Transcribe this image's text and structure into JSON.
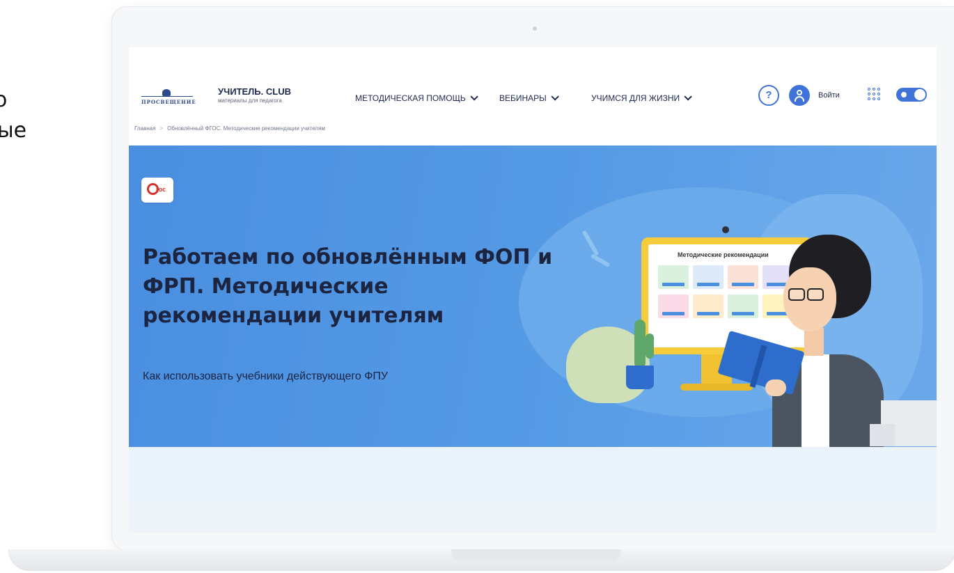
{
  "slide": {
    "line1": "о",
    "line2": "ые"
  },
  "header": {
    "logo_word": "ПРОСВЕЩЕНИЕ",
    "brand_title": "УЧИТЕЛЬ. CLUB",
    "brand_subtitle": "материалы для педагога",
    "nav": [
      {
        "label": "МЕТОДИЧЕСКАЯ ПОМОЩЬ"
      },
      {
        "label": "ВЕБИНАРЫ"
      },
      {
        "label": "УЧИМСЯ ДЛЯ ЖИЗНИ"
      }
    ],
    "help_label": "?",
    "login_label": "Войти"
  },
  "breadcrumb": {
    "home": "Главная",
    "separator": ">",
    "current": "Обновлённый ФГОС. Методические рекомендации учителям"
  },
  "hero": {
    "badge_text": "гос",
    "title": "Работаем по обновлённым ФОП и ФРП. Методические рекомендации учителям",
    "subtitle": "Как использовать учебники действующего ФПУ",
    "monitor_title": "Методические рекомендации"
  },
  "colors": {
    "accent": "#3f73d9",
    "hero_bg": "#569be5",
    "fgos_red": "#d3332b",
    "monitor_yellow": "#f6cc3c"
  },
  "icons": [
    "chevron-down-icon",
    "help-icon",
    "user-icon",
    "apps-grid-icon",
    "theme-toggle-icon",
    "fgos-logo-icon"
  ]
}
